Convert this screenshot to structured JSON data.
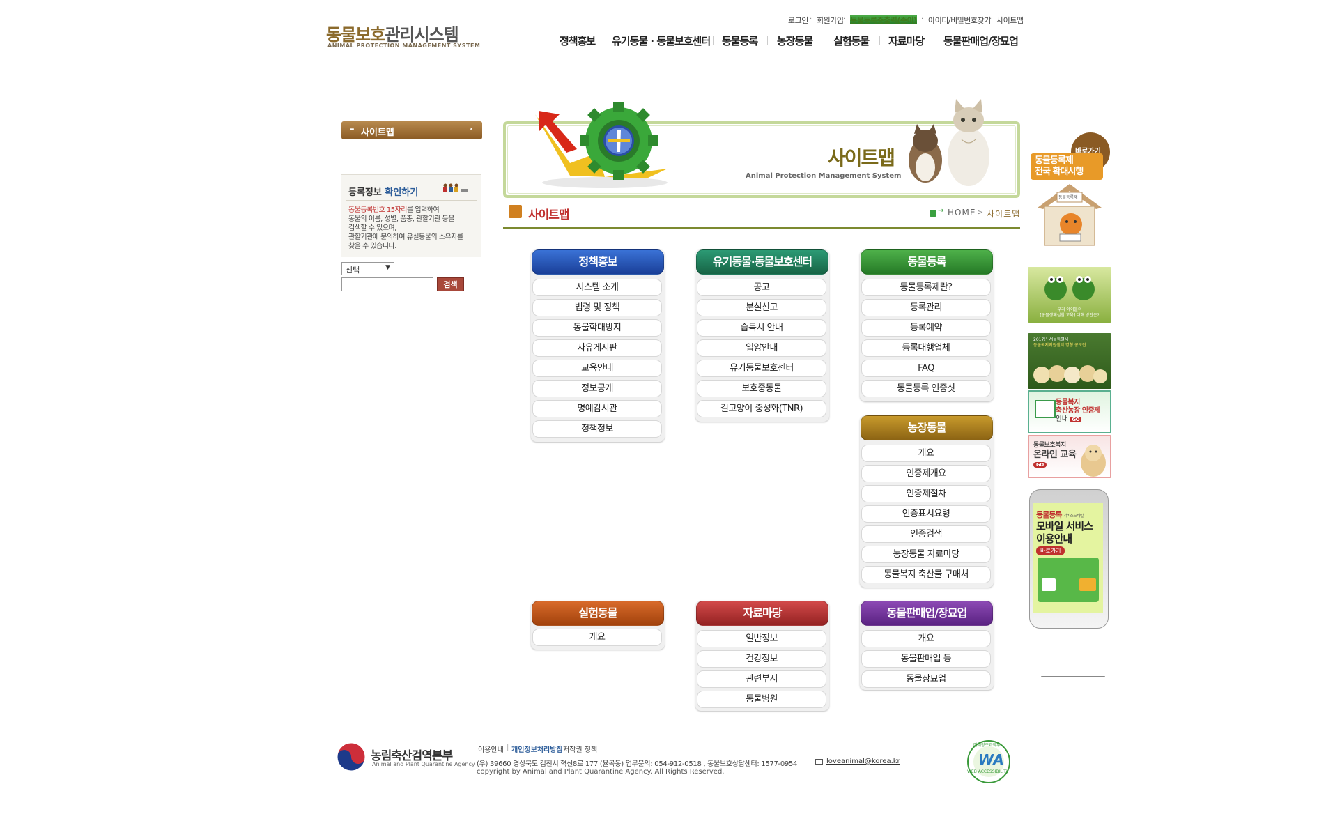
{
  "header": {
    "logo_a": "동물보호",
    "logo_b": "관리시스템",
    "logo_sub": "ANIMAL PROTECTION MANAGEMENT SYSTEM",
    "util": {
      "login": "로그인",
      "join": "회원가입",
      "reg_cert": "동물등록증출력(종이)",
      "find": "아이디/비밀번호찾기",
      "sitemap": "사이트맵"
    },
    "gnb": [
      "정책홍보",
      "유기동물 · 동물보호센터",
      "동물등록",
      "농장동물",
      "실험동물",
      "자료마당",
      "동물판매업/장묘업"
    ]
  },
  "left": {
    "menu_title": "사이트맵",
    "reg_title_a": "등록정보",
    "reg_title_b": "확인하기",
    "desc_hi": "동물등록번호 15자리",
    "desc_1": "를 입력하여",
    "desc_2": "동물의 이름, 성별, 품종, 관할기관 등을",
    "desc_3": "검색할 수 있으며,",
    "desc_4": "관할기관에 문의하여 유실동물의 소유자를",
    "desc_5": "찾을 수 있습니다.",
    "select_value": "선택",
    "search_button": "검색"
  },
  "banner": {
    "title": "사이트맵",
    "subtitle": "Animal Protection Management System"
  },
  "section": {
    "title": "사이트맵",
    "breadcrumb_home": "HOME",
    "breadcrumb_current": "사이트맵"
  },
  "sitemap": [
    {
      "title": "정책홍보",
      "items": [
        "시스템 소개",
        "법령 및 정책",
        "동물학대방지",
        "자유게시판",
        "교육안내",
        "정보공개",
        "명예감시관",
        "정책정보"
      ]
    },
    {
      "title": "유기동물·동물보호센터",
      "items": [
        "공고",
        "분실신고",
        "습득시 안내",
        "입양안내",
        "유기동물보호센터",
        "보호중동물",
        "길고양이 중성화(TNR)"
      ]
    },
    {
      "title": "동물등록",
      "items": [
        "동물등록제란?",
        "등록관리",
        "등록예약",
        "등록대행업체",
        "FAQ",
        "동물등록 인증샷"
      ]
    },
    {
      "title": "농장동물",
      "items": [
        "개요",
        "인증제개요",
        "인증제절차",
        "인증표시요령",
        "인증검색",
        "농장동물 자료마당",
        "동물복지 축산물 구매처"
      ]
    },
    {
      "title": "실험동물",
      "items": [
        "개요"
      ]
    },
    {
      "title": "자료마당",
      "items": [
        "일반정보",
        "건강정보",
        "관련부서",
        "동물병원"
      ]
    },
    {
      "title": "동물판매업/장묘업",
      "items": [
        "개요",
        "동물판매업 등",
        "동물장묘업"
      ]
    }
  ],
  "right_banners": {
    "b1_tag": "바로가기",
    "b1_text1": "동물등록제",
    "b1_text2": "전국 확대시행",
    "b1_sign": "동물등록제",
    "b2_text1": "우리 아이들의",
    "b2_text2": "[동물생체실험 교육] 대해 방안은?",
    "b3_text1": "2017년 서울특별시",
    "b3_text2": "동물복지지원센터 명칭 공모전",
    "b4_text1": "동물복지",
    "b4_text2": "축산농장 인증제",
    "b4_text3": "안내",
    "b5_text1": "동물보호복지",
    "b5_text2": "온라인 교육",
    "go": "GO",
    "phone_title1": "동물등록",
    "phone_title1b": "서비스 모바일",
    "phone_title2": "모바일 서비스",
    "phone_title3": "이용안내",
    "phone_btn": "바로가기"
  },
  "footer": {
    "org_name": "농림축산검역본부",
    "org_en": "Animal and Plant Quarantine Agency",
    "link1": "이용안내",
    "link2": "개인정보처리방침",
    "link3": "저작권 정책",
    "address": "(우) 39660   경상북도 김천시 혁신8로 177 (율곡동)   업무문의: 054-912-0518 ,  동물보호상담센터: 1577-0954",
    "email": "loveanimal@korea.kr",
    "copyright": "copyright by Animal and Plant Quarantine Agency. All Rights Reserved.",
    "wa_mark": "WA",
    "wa_top": "미래창조과학부",
    "wa_bottom": "WEB ACCESSIBILITY"
  },
  "colors": {
    "logo_brown": "#8b6a2c",
    "section_red": "#c0302e",
    "banner_border": "#c4d89a",
    "col_blue": "#1a3f98",
    "col_teal": "#176445",
    "col_green": "#257a26",
    "col_gold": "#8c6414",
    "col_orange": "#a2420c",
    "col_red": "#942222",
    "col_purple": "#5a2282"
  }
}
